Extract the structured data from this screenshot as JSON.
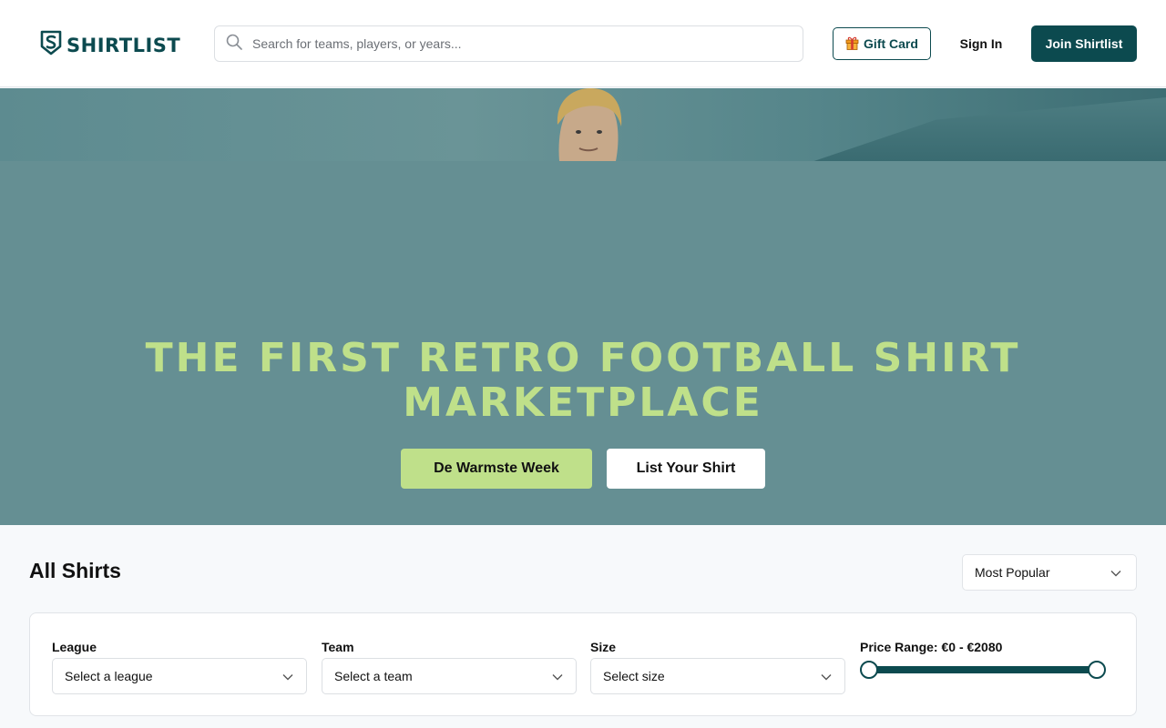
{
  "header": {
    "brand": "SHIRTLIST",
    "search_placeholder": "Search for teams, players, or years...",
    "gift_card_label": "Gift Card",
    "sign_in_label": "Sign In",
    "join_label": "Join Shirtlist"
  },
  "hero": {
    "title_line1": "THE FIRST RETRO FOOTBALL SHIRT",
    "title_line2": "MARKETPLACE",
    "primary_button": "De Warmste Week",
    "secondary_button": "List Your Shirt"
  },
  "shirts": {
    "title": "All Shirts",
    "sort_selected": "Most Popular",
    "filters": {
      "league_label": "League",
      "league_placeholder": "Select a league",
      "team_label": "Team",
      "team_placeholder": "Select a team",
      "size_label": "Size",
      "size_placeholder": "Select size",
      "price_label": "Price Range: €0 - €2080",
      "price_min": 0,
      "price_max": 2080,
      "price_min_fraction": 0,
      "price_max_fraction": 1
    }
  },
  "colors": {
    "brand": "#0c4a4f",
    "accent": "#bfe08a",
    "hero_bg": "#658f93"
  },
  "icons": {
    "logo": "shield-s-icon",
    "search": "search-icon",
    "gift": "gift-icon",
    "chevron": "chevron-down-icon"
  }
}
